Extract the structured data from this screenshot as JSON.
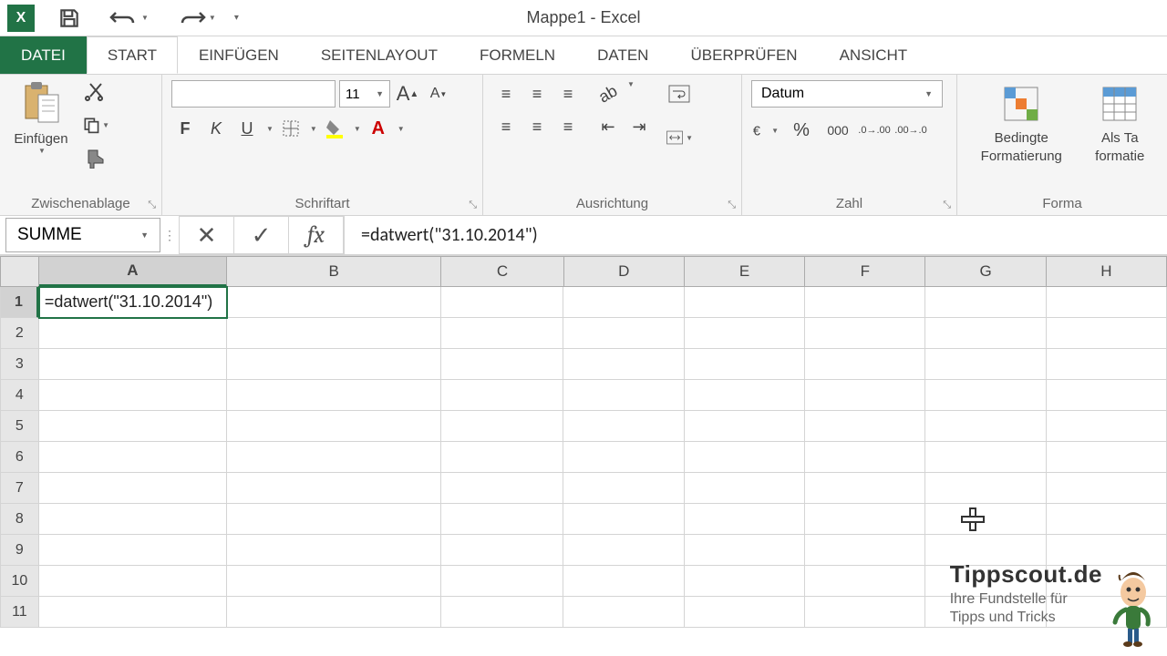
{
  "title": "Mappe1 - Excel",
  "tabs": {
    "file": "DATEI",
    "start": "START",
    "insert": "EINFÜGEN",
    "layout": "SEITENLAYOUT",
    "formulas": "FORMELN",
    "data": "DATEN",
    "review": "ÜBERPRÜFEN",
    "view": "ANSICHT"
  },
  "ribbon": {
    "clipboard": {
      "label": "Zwischenablage",
      "paste": "Einfügen"
    },
    "font": {
      "label": "Schriftart",
      "size": "11"
    },
    "alignment": {
      "label": "Ausrichtung"
    },
    "number": {
      "label": "Zahl",
      "format": "Datum"
    },
    "styles": {
      "label": "Forma",
      "cond": "Bedingte\nFormatierung",
      "table": "Als Ta\nformatie"
    }
  },
  "namebox": "SUMME",
  "formula": "=datwert(\"31.10.2014\")",
  "cellA1": "=datwert(\"31.10.2014\")",
  "cols": [
    "A",
    "B",
    "C",
    "D",
    "E",
    "F",
    "G",
    "H"
  ],
  "rows": [
    "1",
    "2",
    "3",
    "4",
    "5",
    "6",
    "7",
    "8",
    "9",
    "10",
    "11"
  ],
  "watermark": {
    "title": "Tippscout.de",
    "sub1": "Ihre Fundstelle für",
    "sub2": "Tipps und Tricks"
  }
}
